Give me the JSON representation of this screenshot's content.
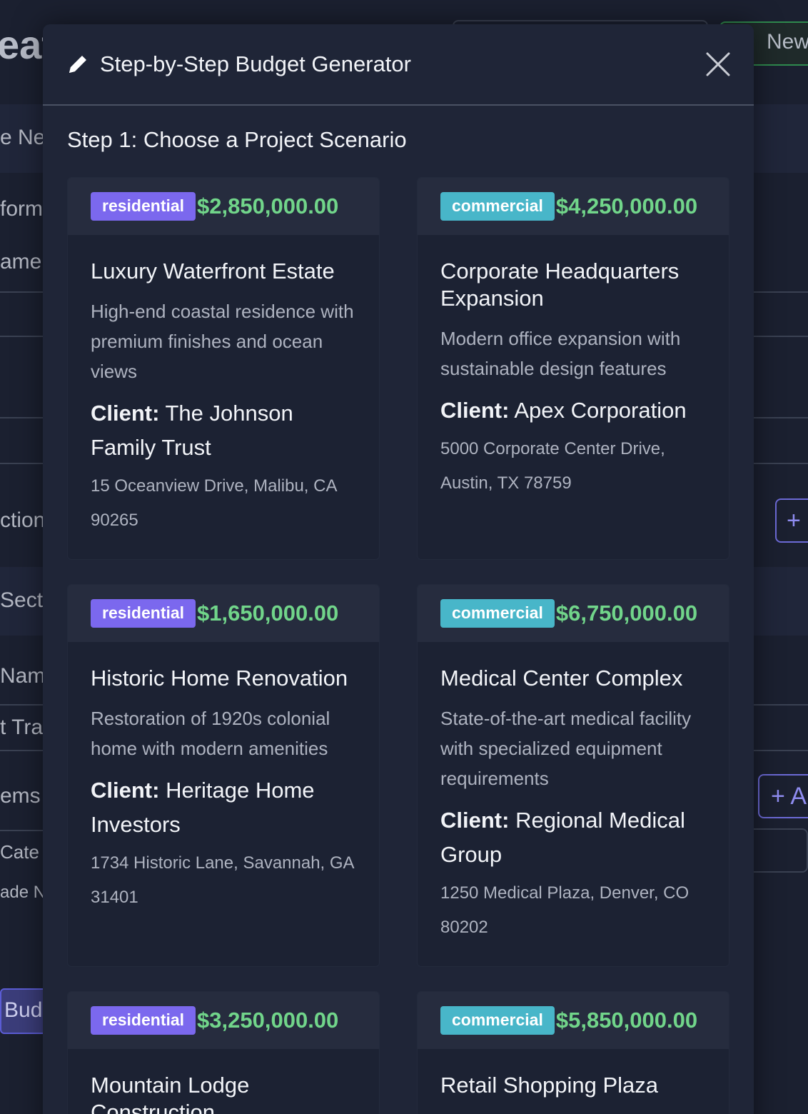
{
  "background": {
    "title_fragment": "eat",
    "new_button_label": "New",
    "labels": [
      "e Ne",
      "form",
      "ame",
      "ction",
      "Secti",
      "Name",
      "t Tra",
      "ems",
      "Cate",
      "ade N"
    ],
    "add_button_1": "+",
    "add_button_2": "+ A",
    "budget_button": "Bud"
  },
  "modal": {
    "title": "Step-by-Step Budget Generator",
    "step_title": "Step 1: Choose a Project Scenario",
    "client_label": "Client:",
    "scenarios": [
      {
        "type": "residential",
        "price": "$2,850,000.00",
        "title": "Luxury Waterfront Estate",
        "description": "High-end coastal residence with premium finishes and ocean views",
        "client": "The Johnson Family Trust",
        "address": "15 Oceanview Drive, Malibu, CA 90265"
      },
      {
        "type": "commercial",
        "price": "$4,250,000.00",
        "title": "Corporate Headquarters Expansion",
        "description": "Modern office expansion with sustainable design features",
        "client": "Apex Corporation",
        "address": "5000 Corporate Center Drive, Austin, TX 78759"
      },
      {
        "type": "residential",
        "price": "$1,650,000.00",
        "title": "Historic Home Renovation",
        "description": "Restoration of 1920s colonial home with modern amenities",
        "client": "Heritage Home Investors",
        "address": "1734 Historic Lane, Savannah, GA 31401"
      },
      {
        "type": "commercial",
        "price": "$6,750,000.00",
        "title": "Medical Center Complex",
        "description": "State-of-the-art medical facility with specialized equipment requirements",
        "client": "Regional Medical Group",
        "address": "1250 Medical Plaza, Denver, CO 80202"
      },
      {
        "type": "residential",
        "price": "$3,250,000.00",
        "title": "Mountain Lodge Construction"
      },
      {
        "type": "commercial",
        "price": "$5,850,000.00",
        "title": "Retail Shopping Plaza"
      }
    ]
  },
  "colors": {
    "residential": "#7b68ee",
    "commercial": "#48b6c9",
    "price": "#71d58a"
  }
}
